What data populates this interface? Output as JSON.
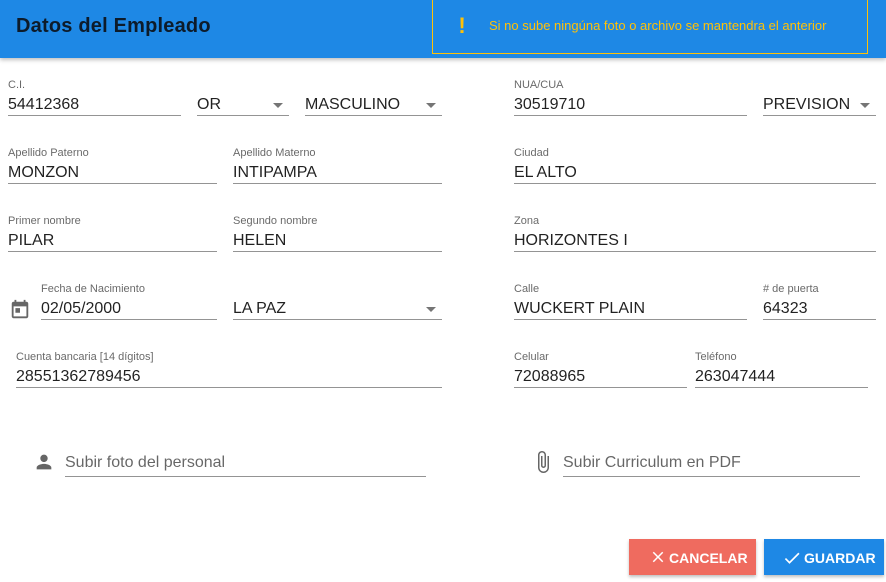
{
  "header": {
    "title": "Datos del Empleado"
  },
  "alert": {
    "icon": "exclamation-icon",
    "message": "Si no sube ningúna foto o archivo se mantendra el anterior",
    "color": "#ffc107"
  },
  "form": {
    "ci": {
      "label": "C.I.",
      "value": "54412368"
    },
    "expedido": {
      "value": "OR"
    },
    "sexo": {
      "value": "MASCULINO"
    },
    "nua": {
      "label": "NUA/CUA",
      "value": "30519710"
    },
    "afp": {
      "value": "PREVISION"
    },
    "apellido_paterno": {
      "label": "Apellido Paterno",
      "value": "MONZON"
    },
    "apellido_materno": {
      "label": "Apellido Materno",
      "value": "INTIPAMPA"
    },
    "ciudad": {
      "label": "Ciudad",
      "value": "EL ALTO"
    },
    "primer_nombre": {
      "label": "Primer nombre",
      "value": "PILAR"
    },
    "segundo_nombre": {
      "label": "Segundo nombre",
      "value": "HELEN"
    },
    "zona": {
      "label": "Zona",
      "value": "HORIZONTES I"
    },
    "fecha_nacimiento": {
      "label": "Fecha de Nacimiento",
      "value": "02/05/2000",
      "icon": "calendar-icon"
    },
    "lugar_nacimiento": {
      "value": "LA PAZ"
    },
    "calle": {
      "label": "Calle",
      "value": "WUCKERT PLAIN"
    },
    "puerta": {
      "label": "# de puerta",
      "value": "64323"
    },
    "cuenta": {
      "label": "Cuenta bancaria [14 dígitos]",
      "value": "28551362789456"
    },
    "celular": {
      "label": "Celular",
      "value": "72088965"
    },
    "telefono": {
      "label": "Teléfono",
      "value": "263047444"
    }
  },
  "uploads": {
    "foto": {
      "placeholder": "Subir foto del personal",
      "icon": "person-icon"
    },
    "cv": {
      "placeholder": "Subir Curriculum en PDF",
      "icon": "paperclip-icon"
    }
  },
  "actions": {
    "cancel": {
      "label": "CANCELAR",
      "icon": "close-icon",
      "color": "#ef6b5f"
    },
    "save": {
      "label": "GUARDAR",
      "icon": "check-icon",
      "color": "#1e88e5"
    }
  },
  "colors": {
    "primary": "#1e88e5",
    "warning": "#ffc107"
  }
}
